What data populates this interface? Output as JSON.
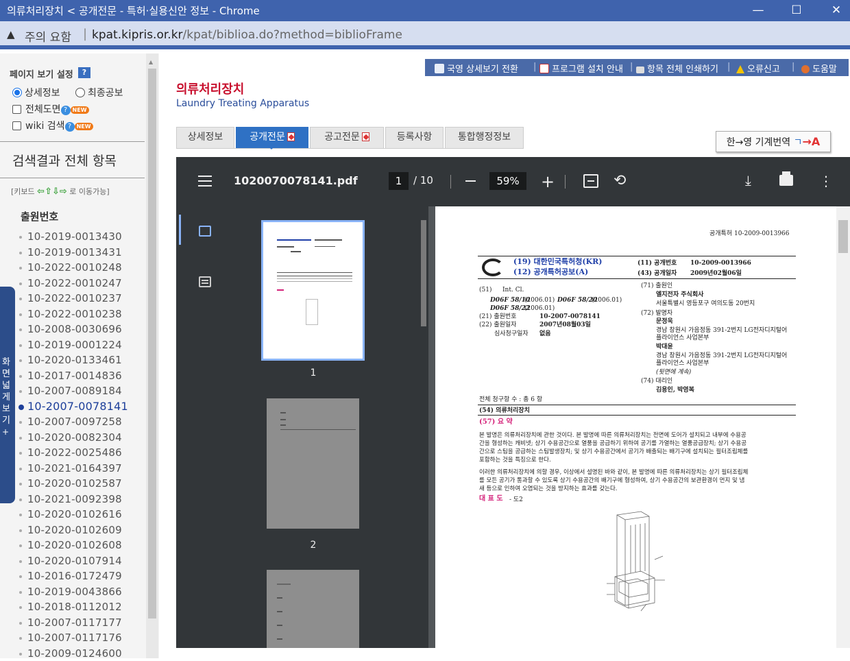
{
  "window": {
    "title": "의류처리장치 < 공개전문 - 특허·실용신안 정보 - Chrome",
    "controls": {
      "minimize": "—",
      "maximize": "☐",
      "close": "✕"
    }
  },
  "address": {
    "warning_label": "주의 요함",
    "url_host": "kpat.kipris.or.kr",
    "url_path": "/kpat/biblioa.do?method=biblioFrame"
  },
  "sidebar": {
    "view_settings_label": "페이지 보기 설정",
    "help_q": "?",
    "radio_detail": "상세정보",
    "radio_final": "최종공보",
    "check_full_drawing": "전체도면",
    "check_wiki": "wiki 검색",
    "new_badge": "NEW",
    "results_title": "검색결과 전체 항목",
    "keyboard_hint_pre": "[키보드",
    "keyboard_hint_post": "로 이동가능]",
    "arrows": {
      "left": "⇦",
      "up": "⇧",
      "down": "⇩",
      "right": "⇨"
    },
    "section_label": "출원번호",
    "numbers": [
      "10-2019-0013430",
      "10-2019-0013431",
      "10-2022-0010248",
      "10-2022-0010247",
      "10-2022-0010237",
      "10-2022-0010238",
      "10-2008-0030696",
      "10-2019-0001224",
      "10-2020-0133461",
      "10-2017-0014836",
      "10-2007-0089184",
      "10-2007-0078141",
      "10-2007-0097258",
      "10-2020-0082304",
      "10-2022-0025486",
      "10-2021-0164397",
      "10-2020-0102587",
      "10-2021-0092398",
      "10-2020-0102616",
      "10-2020-0102609",
      "10-2020-0102608",
      "10-2020-0107914",
      "10-2016-0172479",
      "10-2019-0043866",
      "10-2018-0112012",
      "10-2007-0117177",
      "10-2007-0117176",
      "10-2009-0124600"
    ],
    "active_index": 11,
    "side_tab_text": "화면넓게보기",
    "side_tab_plus": "+"
  },
  "toplinks": {
    "switch_en": "국영 상세보기 전환",
    "install": "프로그램 설치 안내",
    "print_all": "항목 전체 인쇄하기",
    "report": "오류신고",
    "help": "도움말"
  },
  "patent": {
    "title_ko": "의류처리장치",
    "title_en": "Laundry Treating Apparatus"
  },
  "tabs": [
    {
      "label": "상세정보",
      "pdf": false
    },
    {
      "label": "공개전문",
      "pdf": true
    },
    {
      "label": "공고전문",
      "pdf": true
    },
    {
      "label": "등록사항",
      "pdf": false
    },
    {
      "label": "통합행정정보",
      "pdf": false
    }
  ],
  "active_tab": 1,
  "translate": {
    "pre": "한→영 기계번역",
    "ko_glyph": "ㄱ",
    "arrow": "→",
    "a": "A"
  },
  "viewer": {
    "file_name": "1020070078141.pdf",
    "page_current": "1",
    "page_total": "/ 10",
    "zoom": "59%",
    "thumb_labels": [
      "1",
      "2"
    ]
  },
  "doc": {
    "header_right": "공개특허 10-2009-0013966",
    "org": "(19) 대한민국특허청(KR)",
    "pubtype": "(12) 공개특허공보(A)",
    "num11_label": "(11) 공개번호",
    "num11": "10-2009-0013966",
    "num43_label": "(43) 공개일자",
    "num43": "2009년02월06일",
    "ipc_label": "(51)",
    "ipc_head": "Int. Cl.",
    "ipc1": "D06F 58/10",
    "ipc1_date": "(2006.01)",
    "ipc2": "D06F 58/20",
    "ipc2_date": "(2006.01)",
    "ipc3": "D06F 58/22",
    "ipc3_date": "(2006.01)",
    "app_no_label": "(21) 출원번호",
    "app_no": "10-2007-0078141",
    "app_date_label": "(22) 출원일자",
    "app_date": "2007년08월03일",
    "exam_label": "심사청구일자",
    "exam_val": "없음",
    "applicant_label": "(71) 출원인",
    "applicant": "엘지전자 주식회사",
    "applicant_addr": "서울특별시 영등포구 여의도동 20번지",
    "inventor_label": "(72) 발명자",
    "inventor1": "문정욱",
    "inventor1_addr1": "경남 창원시 가음정동 391-2번지 LG전자디지털어",
    "inventor1_addr2": "플라이언스 사업본부",
    "inventor2": "박대윤",
    "inventor2_addr1": "경남 창원시 가음정동 391-2번지 LG전자디지털어",
    "inventor2_addr2": "플라이언스 사업본부",
    "cont": "(뒷면에 계속)",
    "agent_label": "(74) 대리인",
    "agent": "김용인, 박영복",
    "claims": "전체 청구항 수 : 총 6 항",
    "title54": "(54) 의류처리장치",
    "abstract_head": "(57) 요 약",
    "abs1": "본 발명은 의류처리장치에 관한 것이다. 본 발명에 따른 의류처리장치는 전면에 도어가 설치되고 내부에 수용공",
    "abs2": "간을 형성하는 캐비넷; 상기 수용공간으로 열풍을 공급하기 위하여 공기를 가열하는 열풍공급장치; 상기 수용공",
    "abs3": "간으로 스팀을 공급하는 스팀발생장치; 및 상기 수용공간에서 공기가 배출되는 배기구에 설치되는 필터조립체를",
    "abs4": "포함하는 것을 특징으로 한다.",
    "abs5": "이러한 의류처리장치에 의할 경우, 이상에서 설명된 바와 같이, 본 발명에 따른 의류처리장치는 상기 필터조립체",
    "abs6": "를 모든 공기가 통과할 수 있도록 상기 수용공간의 배기구에 형성하여, 상기 수용공간의 보관환경이 먼지 및 냄",
    "abs7": "새 등으로 인하여 오염되는 것을 방지하는 효과를 갖는다.",
    "rep_label": "대 표 도",
    "rep_val": "- 도2"
  },
  "colors": {
    "accent": "#2f71c4",
    "title_red": "#c8102e",
    "titlebar": "#3f63ad"
  }
}
